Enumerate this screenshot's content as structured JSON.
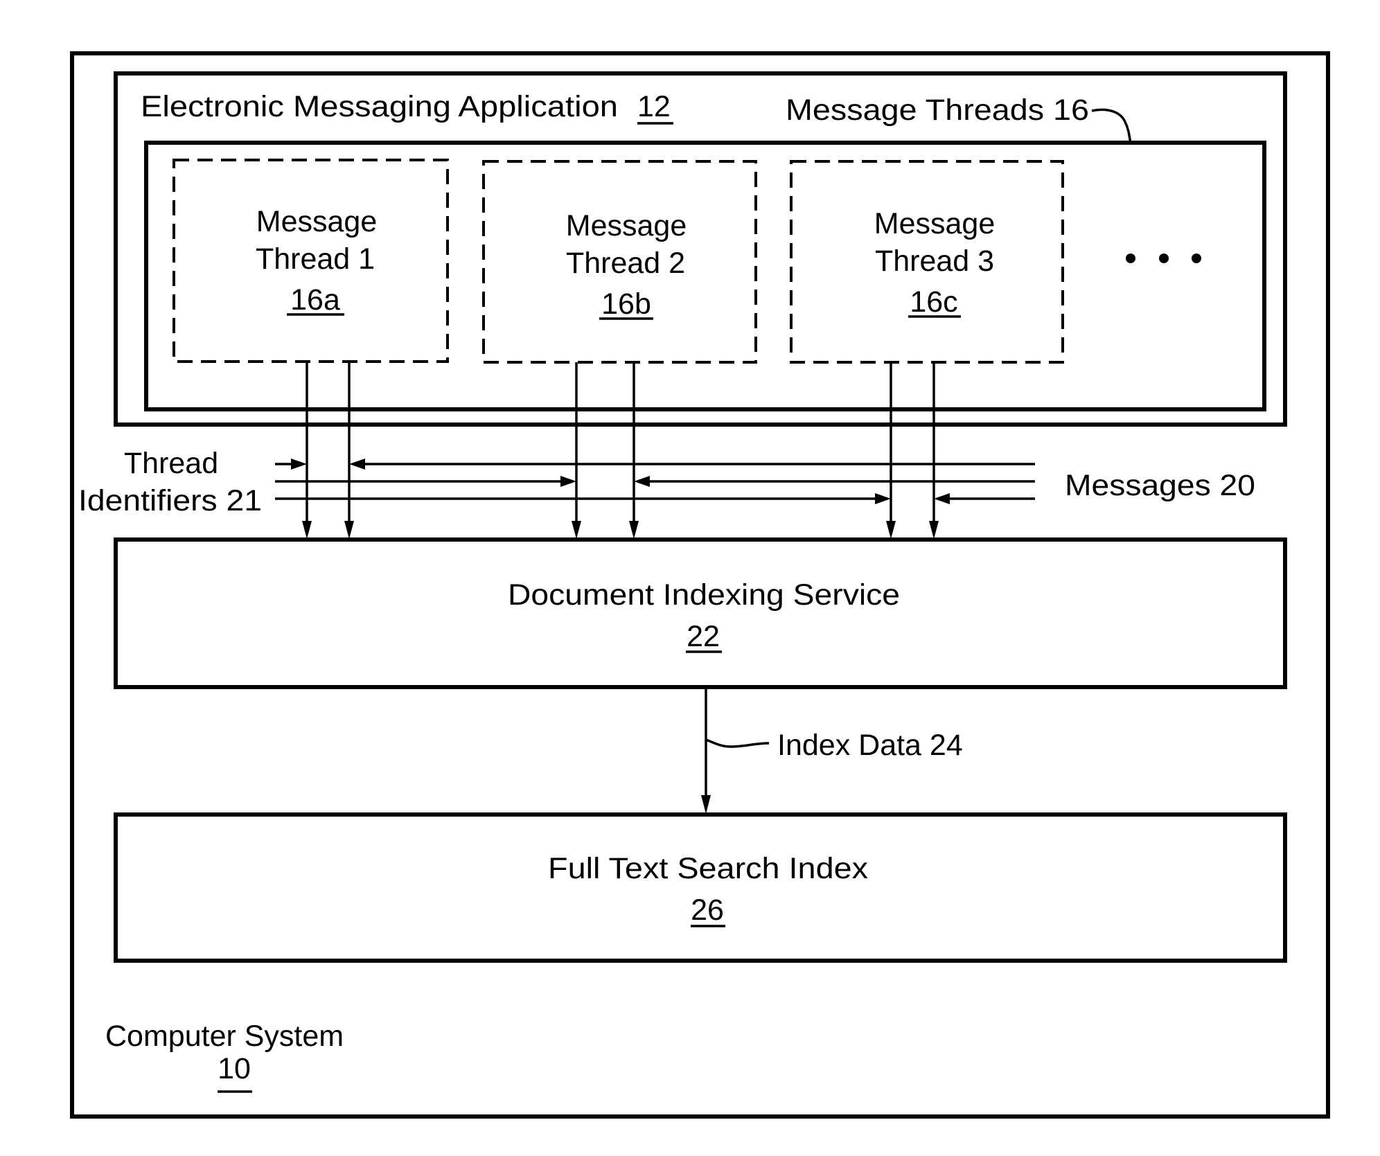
{
  "diagram": {
    "computer_system": {
      "label": "Computer System",
      "ref": "10"
    },
    "app": {
      "label": "Electronic Messaging Application",
      "ref": "12"
    },
    "message_threads": {
      "label": "Message Threads 16"
    },
    "threads": [
      {
        "line1": "Message",
        "line2": "Thread 1",
        "ref": "16a"
      },
      {
        "line1": "Message",
        "line2": "Thread 2",
        "ref": "16b"
      },
      {
        "line1": "Message",
        "line2": "Thread 3",
        "ref": "16c"
      }
    ],
    "ellipsis": "more-threads",
    "thread_identifiers": {
      "line1": "Thread",
      "line2": "Identifiers 21"
    },
    "messages": {
      "label": "Messages 20"
    },
    "indexing_service": {
      "label": "Document Indexing Service",
      "ref": "22"
    },
    "index_data": {
      "label": "Index Data 24"
    },
    "full_text_index": {
      "label": "Full Text Search Index",
      "ref": "26"
    }
  }
}
